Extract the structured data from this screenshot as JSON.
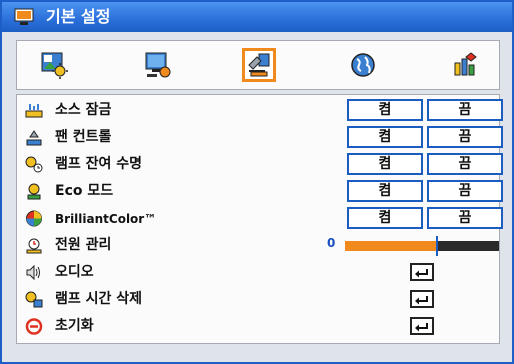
{
  "window": {
    "title": "기본 설정",
    "title_icon": "monitor-menu-icon"
  },
  "tabs": [
    {
      "name": "image-settings-icon",
      "selected": false
    },
    {
      "name": "display-settings-icon",
      "selected": false
    },
    {
      "name": "setup-icon",
      "selected": true
    },
    {
      "name": "language-globe-icon",
      "selected": false
    },
    {
      "name": "advanced-settings-icon",
      "selected": false
    }
  ],
  "rows": [
    {
      "label": "소스 잠금",
      "icon": "source-lock-icon",
      "on": "켬",
      "off": "끔"
    },
    {
      "label": "팬 컨트롤",
      "icon": "fan-control-icon",
      "on": "켬",
      "off": "끔"
    },
    {
      "label": "램프 잔여 수명",
      "icon": "lamp-life-icon",
      "on": "켬",
      "off": "끔"
    },
    {
      "label": "Eco 모드",
      "icon": "eco-mode-icon",
      "on": "켬",
      "off": "끔"
    },
    {
      "label": "BrilliantColor™",
      "icon": "brilliantcolor-icon",
      "on": "켬",
      "off": "끔"
    },
    {
      "label": "전원 관리",
      "icon": "power-management-icon",
      "value": "0",
      "level_fraction": 0.6
    },
    {
      "label": "오디오",
      "icon": "audio-icon",
      "action": "enter-icon"
    },
    {
      "label": "램프 시간 삭제",
      "icon": "lamp-reset-icon",
      "action": "enter-icon"
    },
    {
      "label": "초기화",
      "icon": "reset-icon",
      "action": "enter-icon"
    }
  ],
  "colors": {
    "accent": "#f08a1c",
    "brand_blue": "#1a5cc0",
    "title_bar": "#2a6fda"
  }
}
